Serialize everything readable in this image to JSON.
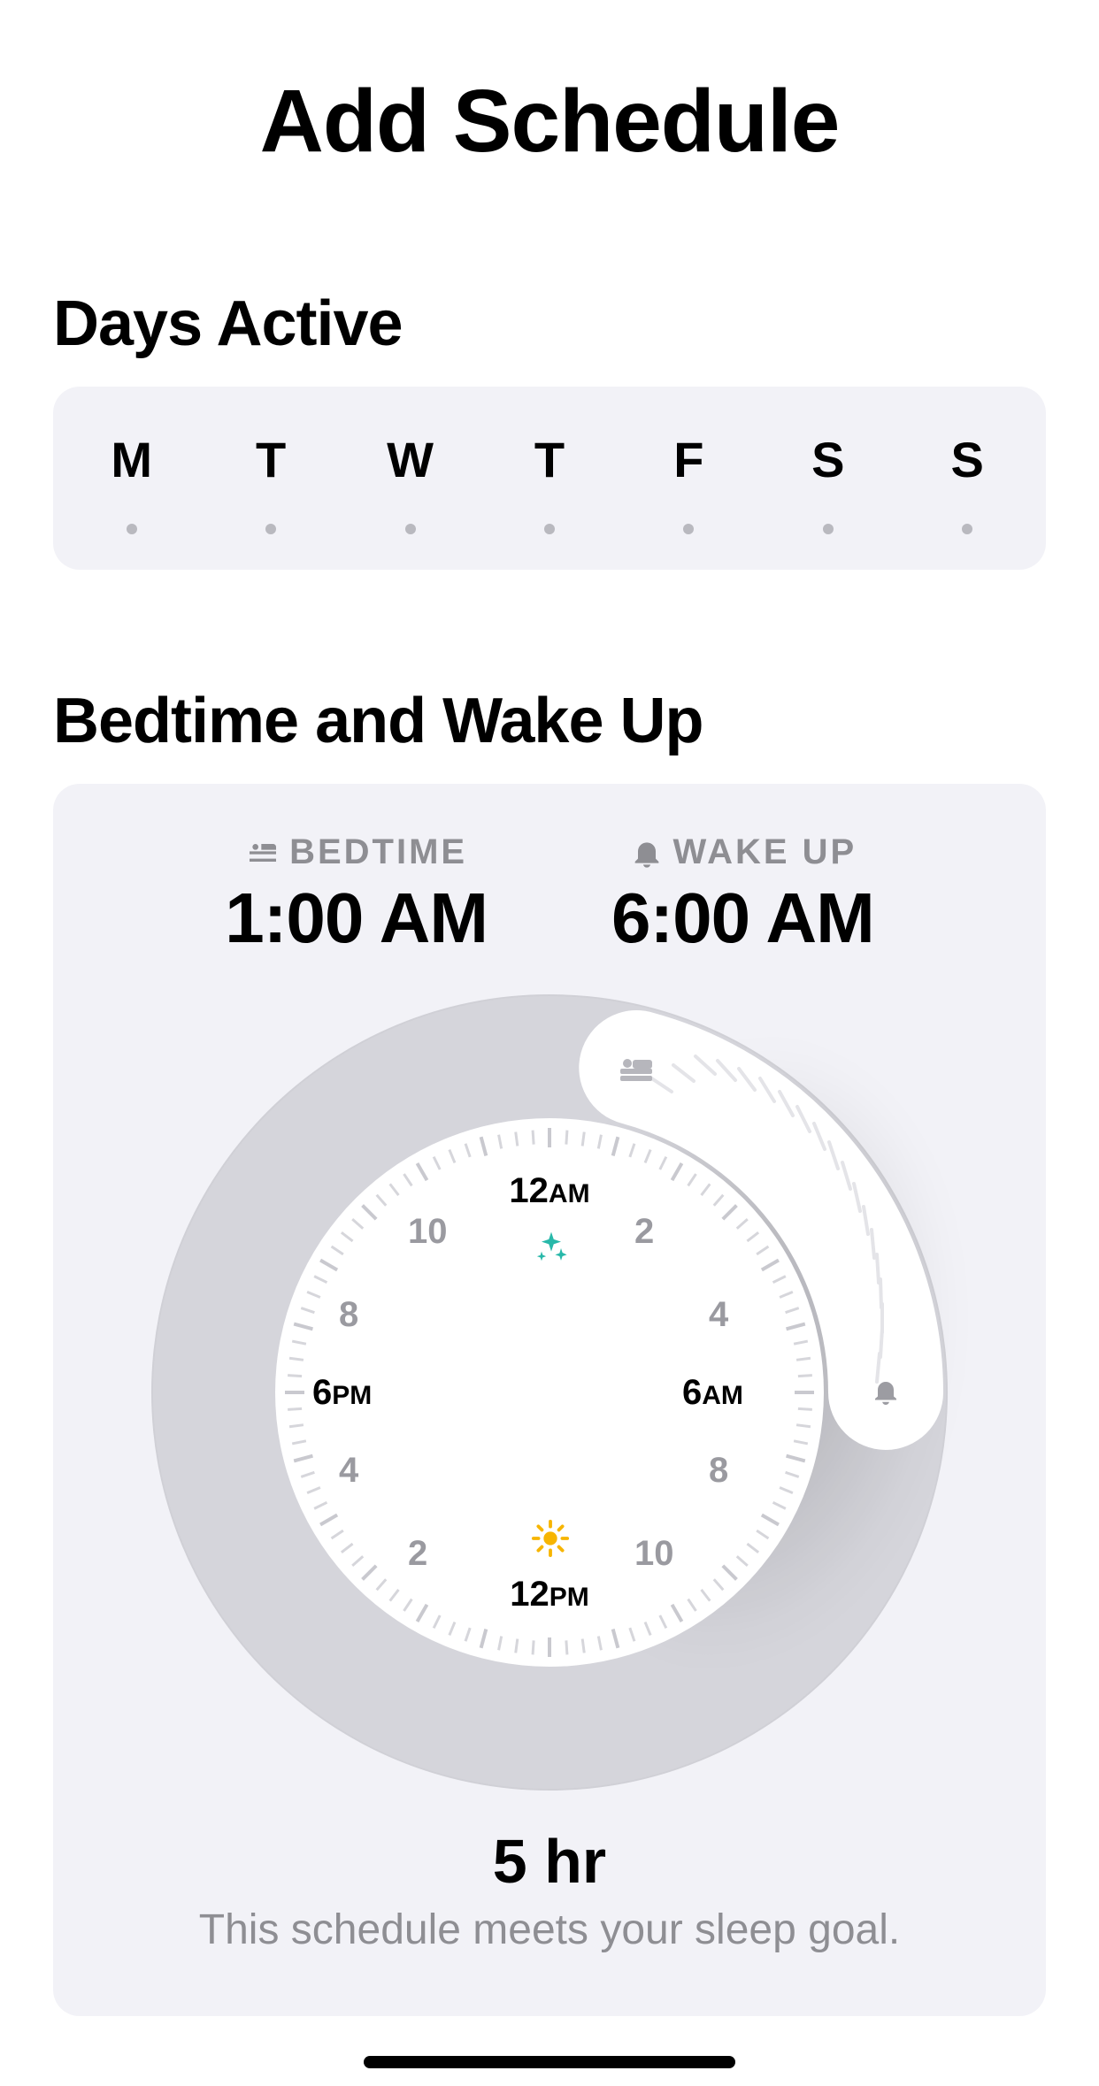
{
  "title": "Add Schedule",
  "sections": {
    "days_label": "Days Active",
    "sleep_label": "Bedtime and Wake Up"
  },
  "days": [
    {
      "letter": "M",
      "selected": false
    },
    {
      "letter": "T",
      "selected": false
    },
    {
      "letter": "W",
      "selected": false
    },
    {
      "letter": "T",
      "selected": false
    },
    {
      "letter": "F",
      "selected": false
    },
    {
      "letter": "S",
      "selected": false
    },
    {
      "letter": "S",
      "selected": false
    }
  ],
  "bedtime": {
    "header": "BEDTIME",
    "value": "1:00 AM"
  },
  "wakeup": {
    "header": "WAKE UP",
    "value": "6:00 AM"
  },
  "face": {
    "top": "12",
    "top_ampm": "AM",
    "right": "6",
    "right_ampm": "AM",
    "bottom": "12",
    "bottom_ampm": "PM",
    "left": "6",
    "left_ampm": "PM",
    "n2": "2",
    "n4": "4",
    "n8": "8",
    "n10": "10"
  },
  "summary": {
    "hours": "5 hr",
    "text": "This schedule meets your sleep goal."
  }
}
